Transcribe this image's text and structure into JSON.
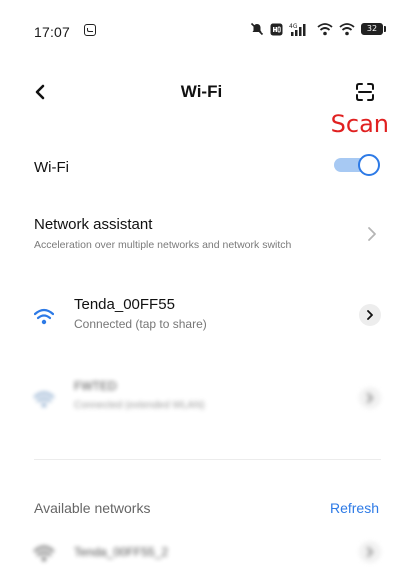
{
  "status_bar": {
    "time": "17:07",
    "network_type": "4G",
    "battery": "32"
  },
  "header": {
    "title": "Wi-Fi",
    "scan_annotation": "Scan"
  },
  "wifi_toggle": {
    "label": "Wi-Fi",
    "enabled": true
  },
  "assistant": {
    "title": "Network assistant",
    "subtitle": "Acceleration over multiple networks and network switch"
  },
  "saved_networks": [
    {
      "name": "Tenda_00FF55",
      "status": "Connected (tap to share)"
    },
    {
      "name": "FWTED",
      "status": "Connected (extended WLAN)"
    }
  ],
  "available": {
    "label": "Available networks",
    "refresh_label": "Refresh",
    "networks": [
      {
        "name": "Tenda_00FF55_2"
      }
    ]
  },
  "colors": {
    "accent": "#2d7ae6",
    "annotation": "#e02020",
    "toggle_track": "#a7c9f3"
  }
}
